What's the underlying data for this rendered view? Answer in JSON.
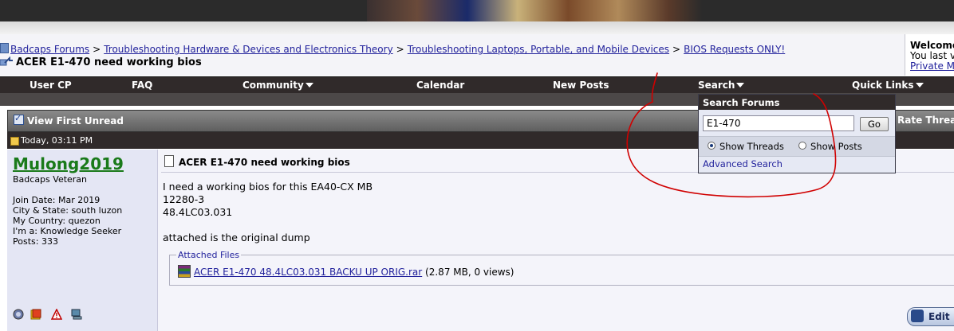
{
  "breadcrumb": {
    "items": [
      "Badcaps Forums",
      "Troubleshooting Hardware & Devices and Electronics Theory",
      "Troubleshooting Laptops, Portable, and Mobile Devices",
      "BIOS Requests ONLY!"
    ],
    "separator": ">",
    "thread_title": "ACER E1-470 need working bios"
  },
  "welcome": {
    "title": "Welcome",
    "line2": "You last v",
    "line3": "Private Me"
  },
  "navbar": {
    "items": [
      {
        "label": "User CP",
        "dropdown": false
      },
      {
        "label": "FAQ",
        "dropdown": false
      },
      {
        "label": "Community",
        "dropdown": true
      },
      {
        "label": "Calendar",
        "dropdown": false
      },
      {
        "label": "New Posts",
        "dropdown": false
      },
      {
        "label": "Search",
        "dropdown": true
      },
      {
        "label": "Quick Links",
        "dropdown": true
      }
    ]
  },
  "post_header": {
    "view_first_unread": "View First Unread",
    "rate_thread": "Rate Thread"
  },
  "post": {
    "date": "Today, 03:11 PM",
    "user": {
      "username": "Mulong2019",
      "title": "Badcaps Veteran",
      "join_date": "Join Date: Mar 2019",
      "city_state": "City & State: south luzon",
      "country": "My Country: quezon",
      "im_a": "I'm a: Knowledge Seeker",
      "posts": "Posts: 333"
    },
    "title": "ACER E1-470 need working bios",
    "message_lines": [
      "I need a working bios for this EA40-CX MB",
      "12280-3",
      "48.4LC03.031",
      "",
      "attached is the original dump"
    ],
    "attachments_legend": "Attached Files",
    "attachment_name": "ACER E1-470 48.4LC03.031 BACKU UP ORIG.rar",
    "attachment_meta": "(2.87 MB, 0 views)",
    "edit_label": "Edit"
  },
  "search_popup": {
    "title": "Search Forums",
    "query": "E1-470",
    "go_label": "Go",
    "option_threads": "Show Threads",
    "option_posts": "Show Posts",
    "selected": "Show Threads",
    "advanced_link": "Advanced Search"
  },
  "colors": {
    "nav_bg": "#302a2a",
    "link": "#22229c",
    "username": "#1a7a1a",
    "annotation": "#d00000"
  }
}
